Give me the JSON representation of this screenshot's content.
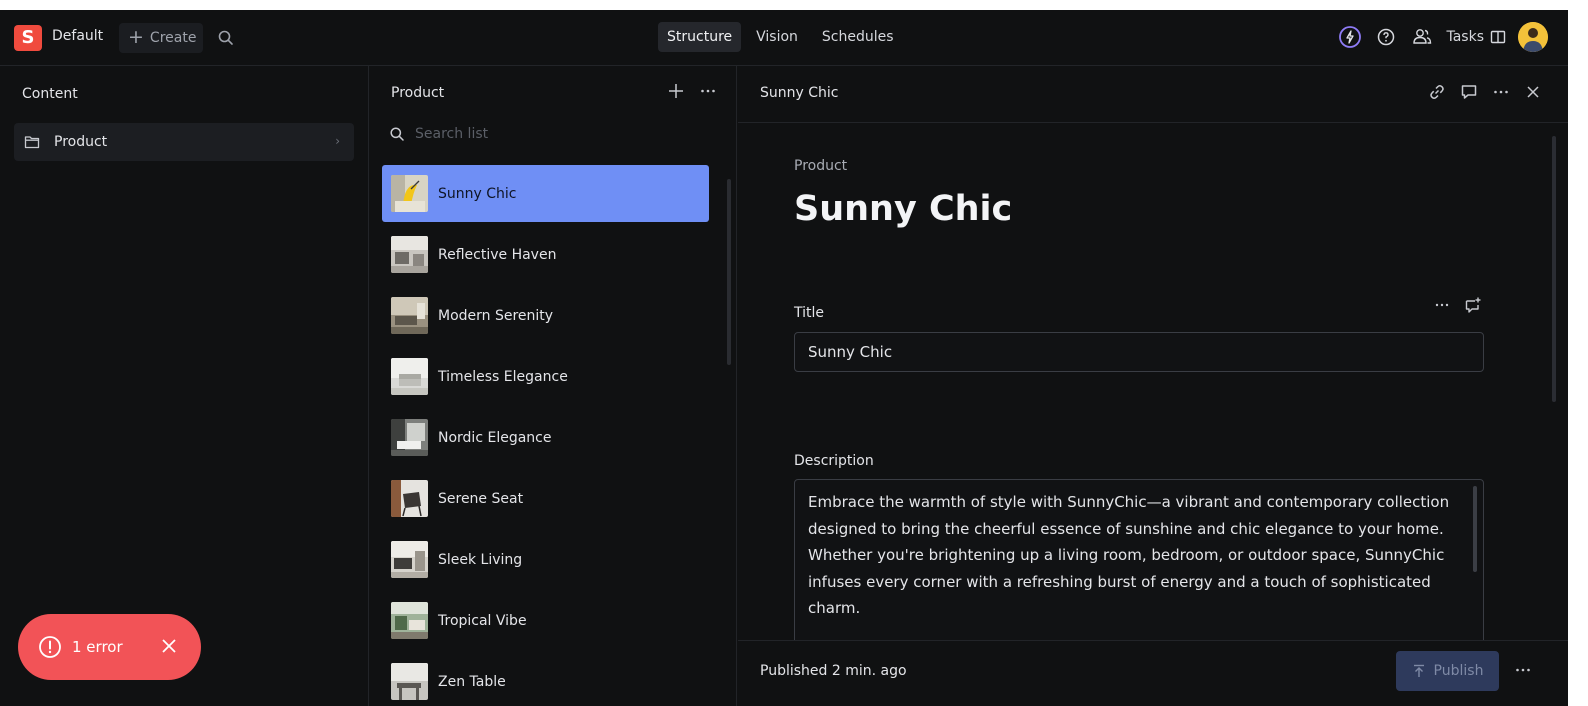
{
  "topbar": {
    "logo_letter": "S",
    "workspace": "Default",
    "create_label": "Create",
    "nav": [
      "Structure",
      "Vision",
      "Schedules"
    ],
    "tasks_label": "Tasks"
  },
  "content_pane": {
    "title": "Content",
    "folder": "Product"
  },
  "list_pane": {
    "title": "Product",
    "search_placeholder": "Search list",
    "items": [
      "Sunny Chic",
      "Reflective Haven",
      "Modern Serenity",
      "Timeless Elegance",
      "Nordic Elegance",
      "Serene Seat",
      "Sleek Living",
      "Tropical Vibe",
      "Zen Table"
    ]
  },
  "document": {
    "pane_title": "Sunny Chic",
    "type_label": "Product",
    "heading": "Sunny Chic",
    "title_label": "Title",
    "title_value": "Sunny Chic",
    "description_label": "Description",
    "description_value": "Embrace the warmth of style with SunnyChic—a vibrant and contemporary collection designed to bring the cheerful essence of sunshine and chic elegance to your home. Whether you're brightening up a living room, bedroom, or outdoor space, SunnyChic infuses every corner with a refreshing burst of energy and a touch of sophisticated charm.",
    "status": "Published 2 min. ago",
    "publish_label": "Publish"
  },
  "toast": {
    "label": "1 error"
  },
  "colors": {
    "background": "#101112",
    "selected": "#6f8ff5",
    "accent": "#f04b3e",
    "error": "#f25357",
    "publish_disabled": "#2e3a5c"
  }
}
